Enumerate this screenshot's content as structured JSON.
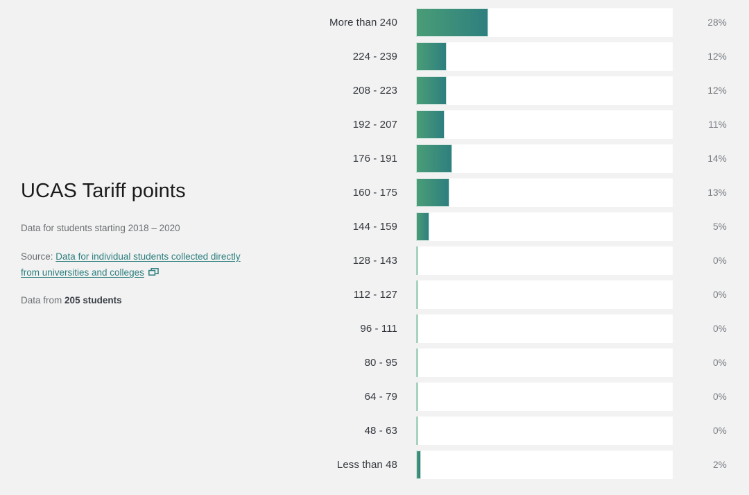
{
  "panel": {
    "title": "UCAS Tariff points",
    "period_label": "Data for students starting 2018 – 2020",
    "source_prefix": "Source:",
    "source_link_text": "Data for individual students collected directly from universities and colleges",
    "external_icon": "open-in-new-window-icon",
    "sample_prefix": "Data from",
    "sample_value": "205 students"
  },
  "colors": {
    "background": "#f2f2f2",
    "bar_gradient_start": "#4a9d76",
    "bar_gradient_end": "#2e7f7f",
    "bar_track": "#ffffff",
    "zero_tick": "#a9d2bf",
    "link": "#2c7d7d",
    "title_text": "#1b1b1b",
    "label_text": "#33373d",
    "value_text": "#7b7f85",
    "meta_text": "#6b6f73"
  },
  "chart_data": {
    "type": "bar",
    "orientation": "horizontal",
    "title": "UCAS Tariff points",
    "subtitle": "Data for students starting 2018 – 2020",
    "xlabel": "",
    "ylabel": "",
    "xlim": [
      0,
      100
    ],
    "grid": false,
    "legend": "none",
    "value_suffix": "%",
    "sample_size": 205,
    "categories": [
      "More than 240",
      "224 - 239",
      "208 - 223",
      "192 - 207",
      "176 - 191",
      "160 - 175",
      "144 - 159",
      "128 - 143",
      "112 - 127",
      "96 - 111",
      "80 - 95",
      "64 - 79",
      "48 - 63",
      "Less than 48"
    ],
    "values": [
      28,
      12,
      12,
      11,
      14,
      13,
      5,
      0,
      0,
      0,
      0,
      0,
      0,
      2
    ],
    "value_labels": [
      "28%",
      "12%",
      "12%",
      "11%",
      "14%",
      "13%",
      "5%",
      "0%",
      "0%",
      "0%",
      "0%",
      "0%",
      "0%",
      "2%"
    ]
  }
}
